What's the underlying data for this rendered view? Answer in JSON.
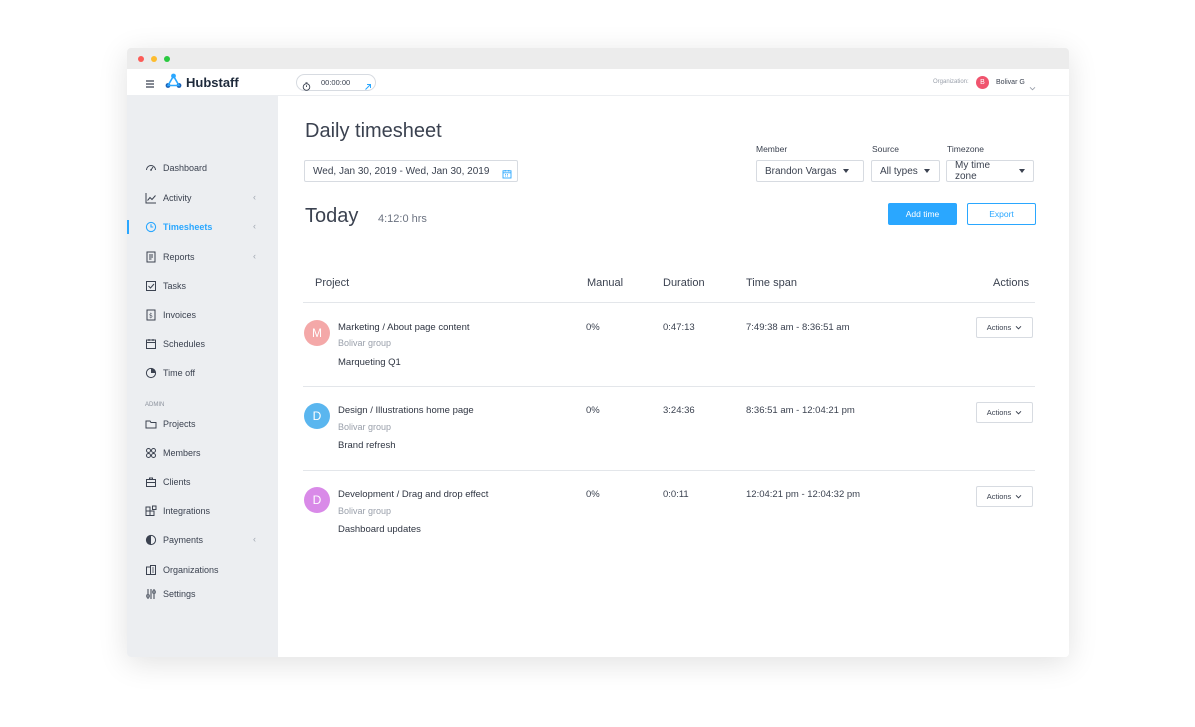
{
  "topbar": {
    "brand": "Hubstaff",
    "timer": "00:00:00",
    "org_label": "Organization:",
    "user_initial": "B",
    "user_name": "Bolivar G"
  },
  "sidebar": {
    "items": [
      {
        "label": "Dashboard",
        "icon": "dashboard-icon"
      },
      {
        "label": "Activity",
        "icon": "activity-icon"
      },
      {
        "label": "Timesheets",
        "icon": "clock-icon",
        "active": true
      },
      {
        "label": "Reports",
        "icon": "reports-icon"
      },
      {
        "label": "Tasks",
        "icon": "tasks-icon"
      },
      {
        "label": "Invoices",
        "icon": "invoices-icon"
      },
      {
        "label": "Schedules",
        "icon": "calendar-icon"
      },
      {
        "label": "Time off",
        "icon": "pie-icon"
      }
    ],
    "admin_label": "ADMIN",
    "admin_items": [
      {
        "label": "Projects",
        "icon": "folder-icon"
      },
      {
        "label": "Members",
        "icon": "members-icon"
      },
      {
        "label": "Clients",
        "icon": "briefcase-icon"
      },
      {
        "label": "Integrations",
        "icon": "integrations-icon"
      },
      {
        "label": "Payments",
        "icon": "payments-icon"
      },
      {
        "label": "Organizations",
        "icon": "organizations-icon"
      },
      {
        "label": "Settings",
        "icon": "settings-icon"
      }
    ]
  },
  "page": {
    "title": "Daily timesheet",
    "date_range": "Wed, Jan 30, 2019 - Wed, Jan 30, 2019",
    "filters": {
      "member_label": "Member",
      "member_value": "Brandon Vargas",
      "source_label": "Source",
      "source_value": "All types",
      "timezone_label": "Timezone",
      "timezone_value": "My time zone"
    },
    "today_label": "Today",
    "today_total": "4:12:0 hrs",
    "add_time_label": "Add time",
    "export_label": "Export"
  },
  "table": {
    "headers": {
      "project": "Project",
      "manual": "Manual",
      "duration": "Duration",
      "time_span": "Time span",
      "actions": "Actions"
    },
    "rows": [
      {
        "initial": "M",
        "color": "#f4a8a8",
        "title": "Marketing / About page content",
        "group": "Bolivar group",
        "task": "Marqueting Q1",
        "manual": "0%",
        "duration": "0:47:13",
        "time_span": "7:49:38 am - 8:36:51 am",
        "action_label": "Actions"
      },
      {
        "initial": "D",
        "color": "#5ab6ef",
        "title": "Design / Illustrations home page",
        "group": "Bolivar group",
        "task": "Brand refresh",
        "manual": "0%",
        "duration": "3:24:36",
        "time_span": "8:36:51 am - 12:04:21 pm",
        "action_label": "Actions"
      },
      {
        "initial": "D",
        "color": "#d98ae8",
        "title": "Development / Drag and drop effect",
        "group": "Bolivar group",
        "task": "Dashboard updates",
        "manual": "0%",
        "duration": "0:0:11",
        "time_span": "12:04:21 pm - 12:04:32 pm",
        "action_label": "Actions"
      }
    ]
  },
  "colors": {
    "accent": "#2aa7ff",
    "sidebar_bg": "#eceef1"
  }
}
